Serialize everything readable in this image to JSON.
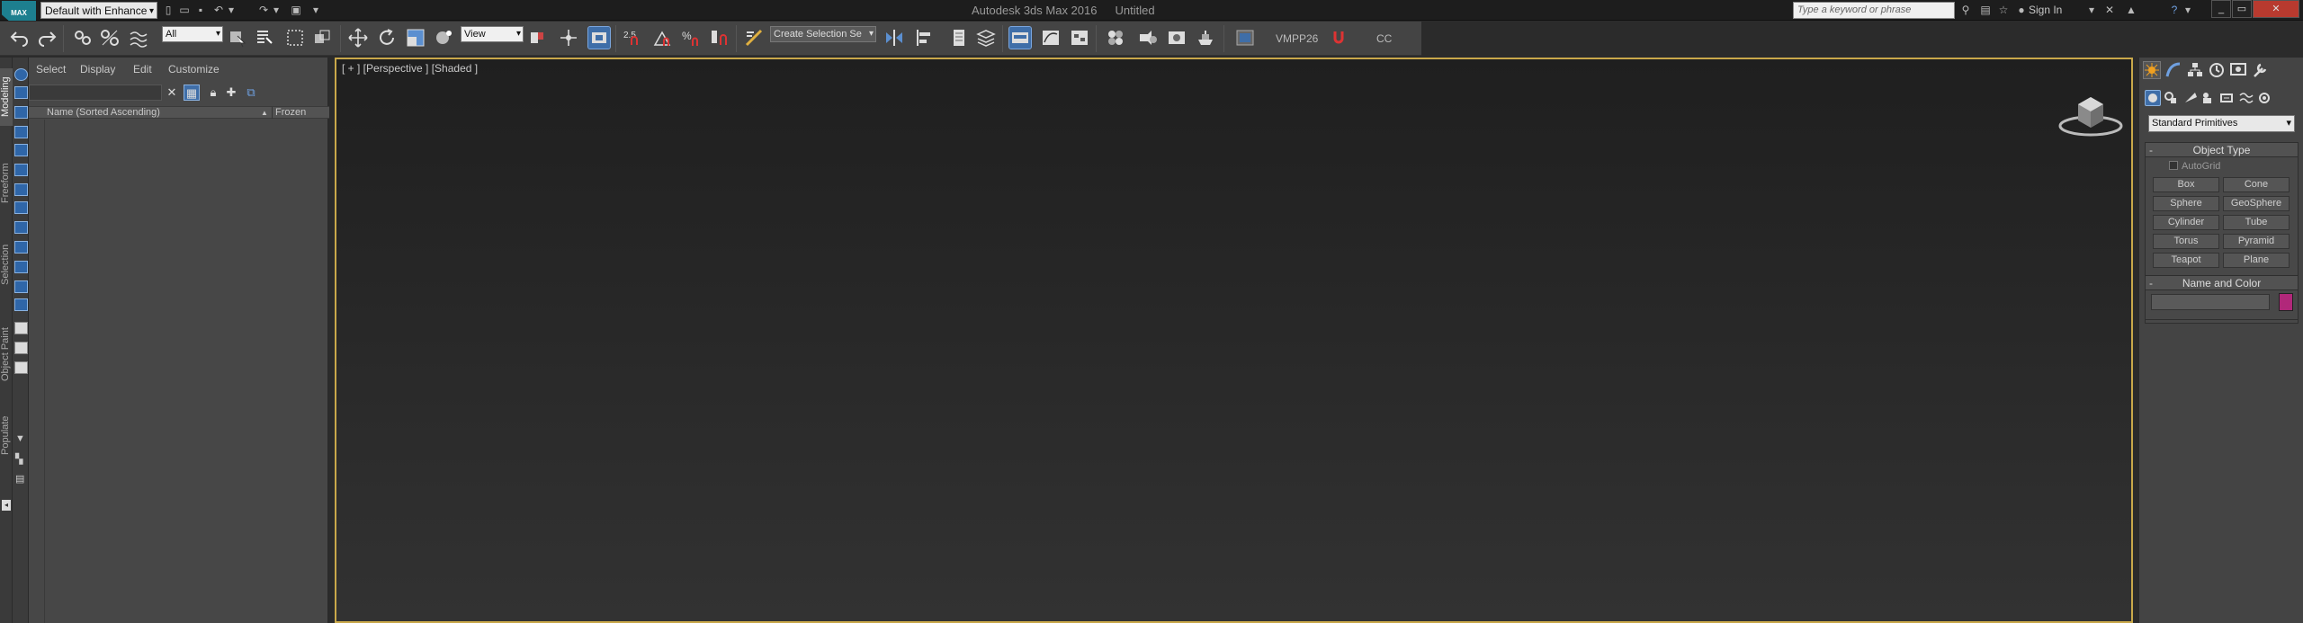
{
  "titlebar": {
    "logo_text": "MAX",
    "workspace": "Default with Enhance",
    "app_title": "Autodesk 3ds Max 2016",
    "doc_title": "Untitled",
    "search_placeholder": "Type a keyword or phrase",
    "signin": "Sign In"
  },
  "toolbar": {
    "filter": "All",
    "coord_system": "View",
    "snap_label": "2.5",
    "selection_set": "Create Selection Se",
    "vmpp": "VMPP26",
    "cc": "CC"
  },
  "left_tabs": [
    "Modeling",
    "Freeform",
    "Selection",
    "Object Paint",
    "Populate"
  ],
  "scene_explorer": {
    "menu": [
      "Select",
      "Display",
      "Edit",
      "Customize"
    ],
    "col_name": "Name (Sorted Ascending)",
    "col_frozen": "Frozen"
  },
  "viewport": {
    "label": "[ + ] [Perspective ] [Shaded ]"
  },
  "command_panel": {
    "category": "Standard Primitives",
    "object_type_title": "Object Type",
    "autogrid": "AutoGrid",
    "primitives": [
      "Box",
      "Cone",
      "Sphere",
      "GeoSphere",
      "Cylinder",
      "Tube",
      "Torus",
      "Pyramid",
      "Teapot",
      "Plane"
    ],
    "name_color_title": "Name and Color",
    "object_color": "#b1287a"
  },
  "colors": {
    "accent": "#3f6ea8",
    "viewport_border": "#c9a84a"
  }
}
